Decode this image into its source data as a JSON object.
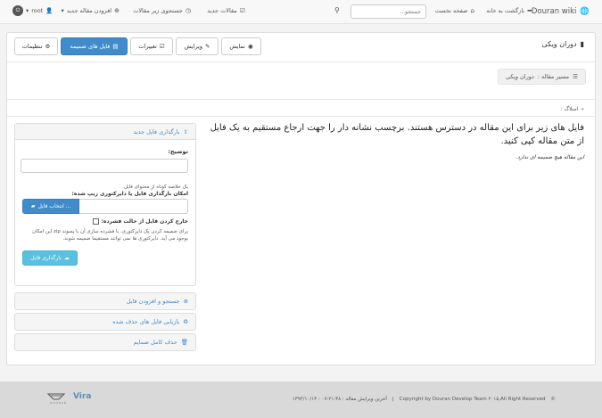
{
  "navbar": {
    "brand": "Douran wiki",
    "back_to_home": "بازگشت به خانه",
    "main_page": "صفحه نخست",
    "search_placeholder": "جستجو...",
    "new_articles": "مقالات جدید",
    "search_articles": "جستجوی زیر مقالات",
    "add_new_article": "افزودن مقاله جدید",
    "user": "root"
  },
  "page": {
    "title": "دوران ویکی",
    "buttons": {
      "view": "نمایش",
      "edit": "ویرایش",
      "changes": "تغییرات",
      "attachments": "فایل های ضمیمه",
      "settings": "تنظیمات"
    },
    "path_label": "مسیر مقاله :",
    "path_value": "دوران ویکی",
    "tags_label": "اسلاگ :"
  },
  "content": {
    "lead": "فایل های زیر برای این مقاله در دسترس هستند. برچسب نشانه دار را جهت ارجاع مستقیم به یک فایل از متن مقاله کپی کنید.",
    "empty": "این مقاله هیچ ضمیمه ای ندارد."
  },
  "upload": {
    "title": "بارگذاری فایل جدید",
    "description_label": "توضیح:",
    "description_help": "یک خلاصه کوتاه از محتوای فایل",
    "zip_label": "امکان بارگذاری فایل یا دایرکتوری زیپ شده:",
    "choose_file": "انتخاب فایل ...",
    "extract_label": "خارج کردن فایل از حالت فشرده:",
    "extract_help": "برای ضمیمه کردن یک دایرکتوری، با فشرده سازی آن با پسوند zip این امکان بوجود می آید. دایرکتوری ها نمی توانند مستقیما ضمیمه شوند.",
    "upload_button": "بارگذاری فایل"
  },
  "accordions": {
    "search_add": "جستجو و افزودن فایل",
    "restore_deleted": "بازیابی فایل های حذف شده",
    "delete_all": "حذف کامل ضمایم"
  },
  "footer": {
    "copyright": "Copyright by Douran Develop Team ۲۰۱۵,All Right Reserved",
    "last_edit": "آخرین ویرایش مقاله : ۰۷:۲۱:۳۸ - ۱۳۹۴/۱۰/۱۳"
  }
}
